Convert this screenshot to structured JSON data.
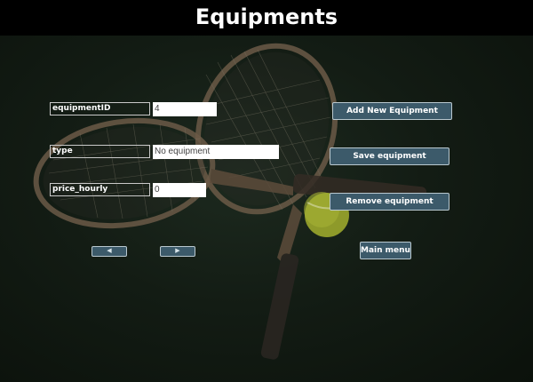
{
  "window": {
    "title": "Equipments"
  },
  "form": {
    "equipment_id": {
      "label": "equipmentID",
      "value": "4"
    },
    "type": {
      "label": "type",
      "value": "No equipment"
    },
    "price_hourly": {
      "label": "price_hourly",
      "value": "0"
    }
  },
  "actions": {
    "add": "Add New Equipment",
    "save": "Save equipment",
    "remove": "Remove equipment",
    "main_menu": "Main menu"
  },
  "navigation": {
    "prev_icon": "triangle-left-icon",
    "next_icon": "triangle-right-icon"
  },
  "colors": {
    "title_bar": "#000000",
    "button": "#3c5a6a",
    "button_border": "#b9c8cf",
    "background": "#131c14"
  }
}
